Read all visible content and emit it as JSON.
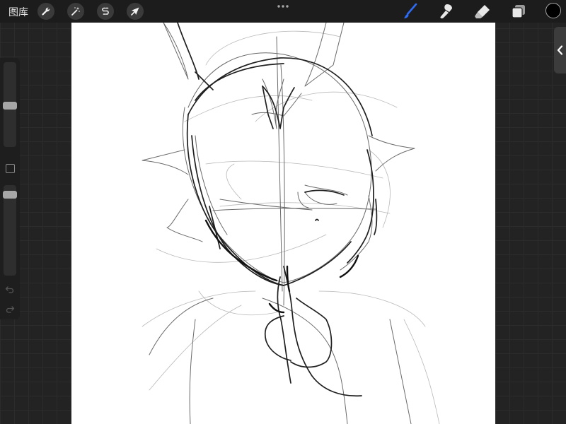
{
  "topbar": {
    "gallery_label": "图库",
    "left_tools": [
      {
        "name": "actions",
        "icon": "wrench-icon"
      },
      {
        "name": "adjustments",
        "icon": "magic-wand-icon"
      },
      {
        "name": "selection",
        "icon": "selection-s-icon"
      },
      {
        "name": "transform",
        "icon": "arrow-cursor-icon"
      }
    ],
    "right_tools": [
      {
        "name": "brush",
        "icon": "brush-icon",
        "active": true
      },
      {
        "name": "smudge",
        "icon": "smudge-icon"
      },
      {
        "name": "eraser",
        "icon": "eraser-icon"
      },
      {
        "name": "layers",
        "icon": "layers-icon"
      }
    ],
    "current_color": "#000000",
    "accent_color": "#2f6cf5"
  },
  "sidebar": {
    "brush_size": 0.48,
    "opacity": 0.02,
    "undo_icon": "undo-icon",
    "redo_icon": "redo-icon"
  },
  "canvas": {
    "background": "#ffffff",
    "content": "sketch-drawing"
  }
}
